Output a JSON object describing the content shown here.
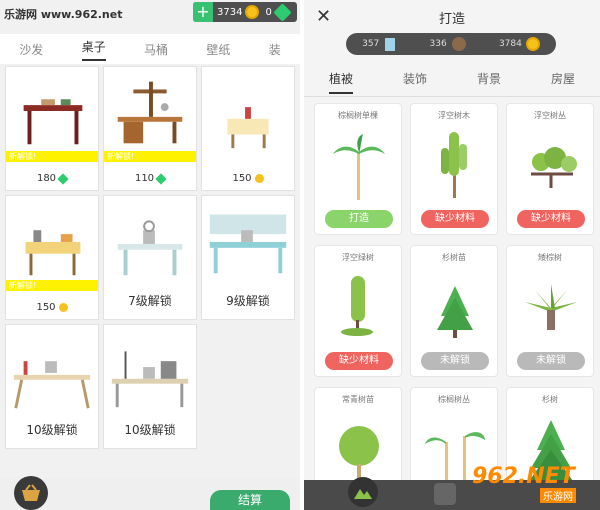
{
  "watermark": "乐游网 www.962.net",
  "left": {
    "currency": {
      "coins": "3734",
      "gems": "0"
    },
    "tabs": [
      "沙发",
      "桌子",
      "马桶",
      "壁纸",
      "装"
    ],
    "active_tab": 1,
    "cards": [
      {
        "badge": "新解锁!",
        "price": "180",
        "currency": "gem"
      },
      {
        "badge": "新解锁!",
        "price": "110",
        "currency": "gem"
      },
      {
        "badge": "",
        "price": "150",
        "currency": "coin"
      },
      {
        "badge": "新解锁!",
        "price": "150",
        "currency": "coin"
      },
      {
        "badge": "",
        "lock": "7级解锁"
      },
      {
        "badge": "",
        "lock": "9级解锁"
      },
      {
        "badge": "",
        "lock": "10级解锁"
      },
      {
        "badge": "",
        "lock": "10级解锁"
      }
    ],
    "settle_label": "结算"
  },
  "right": {
    "title": "打造",
    "resources": [
      "357",
      "336",
      "3784"
    ],
    "tabs": [
      "植被",
      "装饰",
      "背景",
      "房屋"
    ],
    "items": [
      {
        "name": "棕榈树单棵",
        "btn": "打造",
        "state": "green"
      },
      {
        "name": "浮空树木",
        "btn": "缺少材料",
        "state": "red"
      },
      {
        "name": "浮空树丛",
        "btn": "缺少材料",
        "state": "red"
      },
      {
        "name": "浮空绿树",
        "btn": "缺少材料",
        "state": "red"
      },
      {
        "name": "杉树苗",
        "btn": "未解锁",
        "state": "gray"
      },
      {
        "name": "矮棕树",
        "btn": "未解锁",
        "state": "gray"
      },
      {
        "name": "常青树苗",
        "btn": "",
        "state": "none"
      },
      {
        "name": "棕榈树丛",
        "btn": "",
        "state": "none"
      },
      {
        "name": "杉树",
        "btn": "",
        "state": "none"
      }
    ],
    "watermark": "962.NET",
    "watermark_sub": "乐游网"
  },
  "colors": {
    "accent_green": "#3aaa6d",
    "new_badge": "#fff200",
    "btn_red": "#f0645f"
  }
}
